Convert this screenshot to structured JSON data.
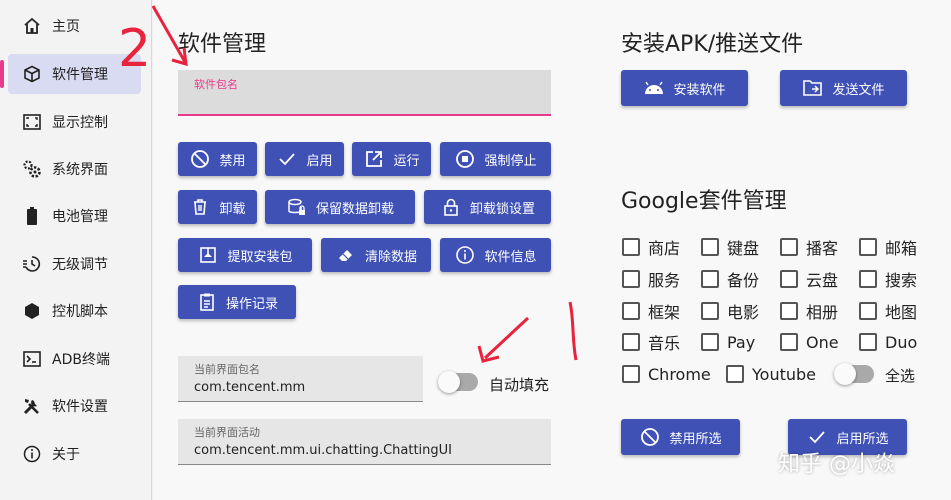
{
  "sidebar": {
    "items": [
      {
        "label": "主页",
        "icon": "home-icon"
      },
      {
        "label": "软件管理",
        "icon": "package-icon",
        "active": true
      },
      {
        "label": "显示控制",
        "icon": "screen-frame-icon"
      },
      {
        "label": "系统界面",
        "icon": "gears-icon"
      },
      {
        "label": "电池管理",
        "icon": "battery-icon"
      },
      {
        "label": "无级调节",
        "icon": "sun-dial-icon"
      },
      {
        "label": "控机脚本",
        "icon": "hexagon-icon"
      },
      {
        "label": "ADB终端",
        "icon": "terminal-icon"
      },
      {
        "label": "软件设置",
        "icon": "tools-icon"
      },
      {
        "label": "关于",
        "icon": "info-icon"
      }
    ]
  },
  "app_manage": {
    "title": "软件管理",
    "package_placeholder": "软件包名",
    "package_value": "",
    "buttons": {
      "disable": "禁用",
      "enable": "启用",
      "run": "运行",
      "force_stop": "强制停止",
      "uninstall": "卸载",
      "keep_data_uninstall": "保留数据卸载",
      "uninstall_lock": "卸载锁设置",
      "extract": "提取安装包",
      "clear_data": "清除数据",
      "app_info": "软件信息",
      "op_log": "操作记录"
    },
    "current_package": {
      "label": "当前界面包名",
      "value": "com.tencent.mm"
    },
    "current_activity": {
      "label": "当前界面活动",
      "value": "com.tencent.mm.ui.chatting.ChattingUI"
    },
    "auto_fill": {
      "label": "自动填充",
      "on": false
    }
  },
  "install": {
    "title": "安装APK/推送文件",
    "install_btn": "安装软件",
    "push_btn": "发送文件"
  },
  "google": {
    "title": "Google套件管理",
    "items": [
      "商店",
      "键盘",
      "播客",
      "邮箱",
      "服务",
      "备份",
      "云盘",
      "搜索",
      "框架",
      "电影",
      "相册",
      "地图",
      "音乐",
      "Pay",
      "One",
      "Duo",
      "Chrome",
      "Youtube"
    ],
    "select_all": {
      "label": "全选",
      "on": false
    },
    "disable_selected": "禁用所选",
    "enable_selected": "启用所选"
  },
  "annotation": {
    "number": "2"
  },
  "watermark": "知乎 @小焱",
  "colors": {
    "accent": "#3f51b5",
    "highlight": "#e83a8a",
    "annotation": "#e8233d"
  }
}
